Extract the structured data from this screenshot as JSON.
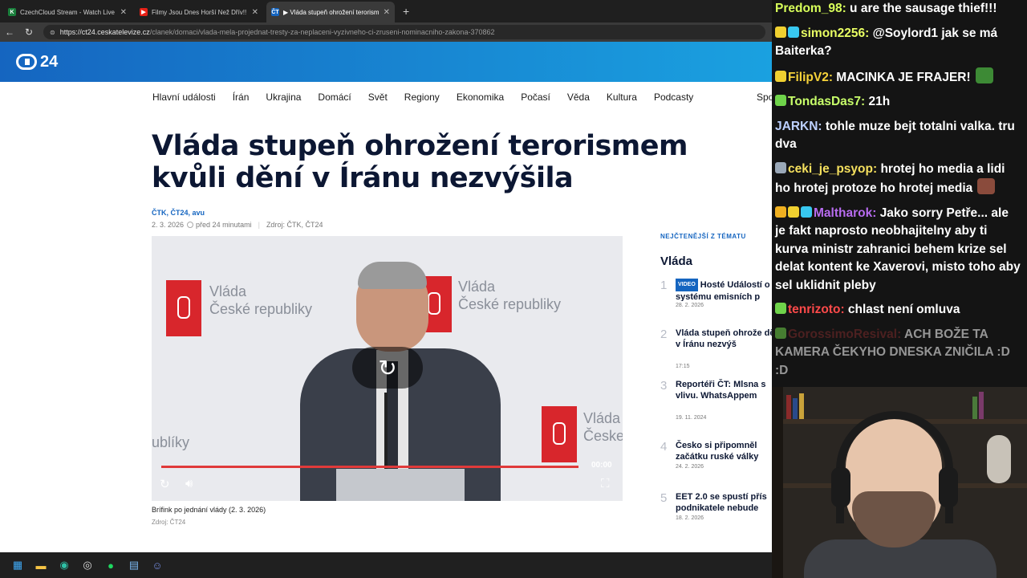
{
  "browser": {
    "tabs": [
      {
        "title": "CzechCloud Stream - Watch Live o",
        "fav": "K",
        "favColor": "#1a7f3c",
        "active": false
      },
      {
        "title": "Filmy Jsou Dnes Horší Než Dřív!! -",
        "fav": "▶",
        "favColor": "#e62117",
        "active": false
      },
      {
        "title": "▶ Vláda stupeň ohrožení terorisme",
        "fav": "ČT",
        "favColor": "#1565c0",
        "active": true
      }
    ],
    "url_domain": "https://ct24.ceskatelevize.cz",
    "url_path": "/clanek/domaci/vlada-mela-projednat-tresty-za-neplaceni-vyzivneho-ci-zruseni-nominacniho-zakona-370862"
  },
  "site": {
    "logo_text": "24",
    "nav": [
      "Hlavní události",
      "Írán",
      "Ukrajina",
      "Domácí",
      "Svět",
      "Regiony",
      "Ekonomika",
      "Počasí",
      "Věda",
      "Kultura",
      "Podcasty"
    ],
    "nav_more": "Spo"
  },
  "article": {
    "headline": "Vláda stupeň ohrožení terorismem kvůli dění v Íránu nezvýšila",
    "authors": "ČTK, ČT24, avu",
    "date": "2. 3. 2026",
    "ago": "před 24 minutami",
    "source": "Zdroj: ČTK, ČT24",
    "video": {
      "time": "00:00",
      "banner_text_1": "Vláda",
      "banner_text_2": "České republiky",
      "banner_text_short": "ublíky",
      "progress": 1.0
    },
    "caption": "Brífink po jednání vlády (2. 3. 2026)",
    "caption_source": "Zdroj: ČT24"
  },
  "sidebar": {
    "kicker": "NEJČTENĚJŠÍ Z TÉMATU",
    "title": "Vláda",
    "items": [
      {
        "num": "1",
        "badge": "VIDEO",
        "title": "Hosté Událostí o systému emisních p",
        "date": "28. 2. 2026"
      },
      {
        "num": "2",
        "badge": "",
        "title": "Vláda stupeň ohrože dění v Íránu nezvýš",
        "date": "17:15"
      },
      {
        "num": "3",
        "badge": "",
        "title": "Reportéři ČT: Mlsna s vlivu. WhatsAppem zastánce",
        "date": "19. 11. 2024"
      },
      {
        "num": "4",
        "badge": "",
        "title": "Česko si připomněl začátku ruské války",
        "date": "24. 2. 2026"
      },
      {
        "num": "5",
        "badge": "",
        "title": "EET 2.0 se spustí přís podnikatele nebude",
        "date": "18. 2. 2026"
      }
    ]
  },
  "chat": [
    {
      "user": "Predom_98",
      "color": "#d8ff5a",
      "text": "u are the sausage thief!!!",
      "badges": []
    },
    {
      "user": "simon2256",
      "color": "#e9ff63",
      "text": "@Soylord1 jak se má Baiterka?",
      "badges": [
        "#f0d030",
        "#38c8f0"
      ]
    },
    {
      "user": "FilipV2",
      "color": "#f7d33a",
      "text": "MACINKA JE FRAJER!",
      "badges": [
        "#f0d030"
      ],
      "emote": "#3d8a35"
    },
    {
      "user": "TondasDas7",
      "color": "#c8ff6a",
      "text": "21h",
      "badges": [
        "#6fd34a"
      ]
    },
    {
      "user": "JARKN",
      "color": "#bcd0ff",
      "text": "tohle muze bejt totalni valka. tru dva",
      "badges": []
    },
    {
      "user": "ceki_je_psyop",
      "color": "#f5e05e",
      "text": "hrotej ho media a lidi ho hrotej protoze ho hrotej media",
      "badges": [
        "#9aa8b8"
      ],
      "emote": "#8a4b3c"
    },
    {
      "user": "Maltharok",
      "color": "#b86cf0",
      "text": "Jako sorry Petře... ale je fakt naprosto neobhajitelny aby ti kurva ministr zahranici behem krize sel delat kontent ke Xaverovi, misto toho aby sel uklidnit pleby",
      "badges": [
        "#f0b020",
        "#f0d030",
        "#38c8f0"
      ]
    },
    {
      "user": "tenrizoto",
      "color": "#ff4a4a",
      "text": "chlast není omluva",
      "badges": [
        "#6fd34a"
      ]
    },
    {
      "user": "GorossimoResival",
      "color": "#7a2a2a",
      "text": "ACH BOŽE TA KAMERA ČEKYHO DNESKA ZNIČILA :D :D",
      "badges": [
        "#6fd34a"
      ],
      "faded": true
    }
  ],
  "taskbar": [
    {
      "icon": "windows-icon",
      "glyph": "▦",
      "color": "#3fa9f5"
    },
    {
      "icon": "file-explorer-icon",
      "glyph": "▬",
      "color": "#f6c445"
    },
    {
      "icon": "edge-icon",
      "glyph": "◉",
      "color": "#2ebfa5"
    },
    {
      "icon": "obs-icon",
      "glyph": "◎",
      "color": "#ddd"
    },
    {
      "icon": "spotify-icon",
      "glyph": "●",
      "color": "#1ed760"
    },
    {
      "icon": "notepad-icon",
      "glyph": "▤",
      "color": "#7ab8f0"
    },
    {
      "icon": "discord-icon",
      "glyph": "☺",
      "color": "#7289da"
    }
  ]
}
